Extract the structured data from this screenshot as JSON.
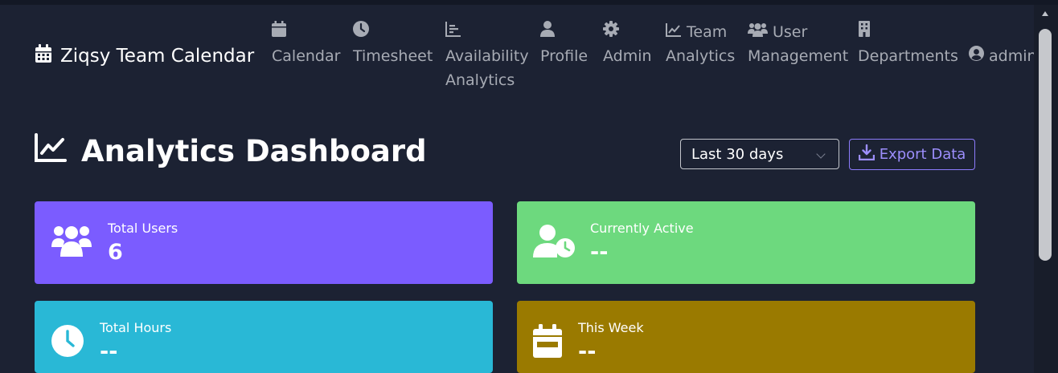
{
  "brand": {
    "name": "Ziqsy Team Calendar",
    "icon": "calendar-icon"
  },
  "nav": {
    "calendar": {
      "label": "Calendar",
      "icon": "calendar-icon"
    },
    "timesheet": {
      "label": "Timesheet",
      "icon": "clock-icon"
    },
    "availability": {
      "line1": "Availability",
      "line2": "Analytics",
      "icon": "bar-chart-icon"
    },
    "profile": {
      "label": "Profile",
      "icon": "user-icon"
    },
    "admin": {
      "label": "Admin",
      "icon": "gear-icon"
    },
    "team_analytics": {
      "line1": "Team",
      "line2": "Analytics",
      "icon": "line-chart-icon"
    },
    "user_management": {
      "line1": "User",
      "line2": "Management",
      "icon": "users-icon"
    },
    "departments": {
      "label": "Departments",
      "icon": "building-icon"
    },
    "account": {
      "label": "admin",
      "icon": "user-circle-icon"
    }
  },
  "page": {
    "title": "Analytics Dashboard",
    "icon": "line-chart-icon"
  },
  "controls": {
    "period": "Last 30 days",
    "export_label": "Export Data",
    "export_icon": "download-icon"
  },
  "stats": [
    {
      "label": "Total Users",
      "value": "6",
      "color": "#7b5cff",
      "icon": "users-icon"
    },
    {
      "label": "Currently Active",
      "value": "--",
      "color": "#6dd97e",
      "icon": "user-clock-icon"
    },
    {
      "label": "Total Hours",
      "value": "--",
      "color": "#29b8d6",
      "icon": "clock-icon"
    },
    {
      "label": "This Week",
      "value": "--",
      "color": "#9a7a00",
      "icon": "calendar-week-icon"
    }
  ]
}
